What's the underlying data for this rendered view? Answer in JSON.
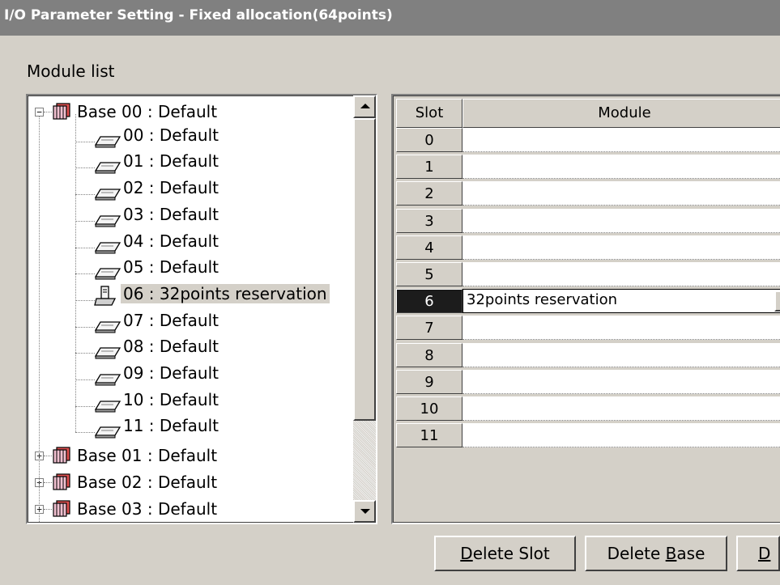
{
  "window": {
    "title": "I/O Parameter Setting - Fixed allocation(64points)"
  },
  "module_list": {
    "label": "Module list"
  },
  "tree": {
    "bases": [
      {
        "label": "Base 00 : Default",
        "expanded": true,
        "expander": "−",
        "children": [
          {
            "label": "00 : Default",
            "icon": "module-icon"
          },
          {
            "label": "01 : Default",
            "icon": "module-icon"
          },
          {
            "label": "02 : Default",
            "icon": "module-icon"
          },
          {
            "label": "03 : Default",
            "icon": "module-icon"
          },
          {
            "label": "04 : Default",
            "icon": "module-icon"
          },
          {
            "label": "05 : Default",
            "icon": "module-icon"
          },
          {
            "label": "06 : 32points reservation",
            "icon": "reservation-icon",
            "selected": true
          },
          {
            "label": "07 : Default",
            "icon": "module-icon"
          },
          {
            "label": "08 : Default",
            "icon": "module-icon"
          },
          {
            "label": "09 : Default",
            "icon": "module-icon"
          },
          {
            "label": "10 : Default",
            "icon": "module-icon"
          },
          {
            "label": "11 : Default",
            "icon": "module-icon"
          }
        ]
      },
      {
        "label": "Base 01 : Default",
        "expanded": false,
        "expander": "+"
      },
      {
        "label": "Base 02 : Default",
        "expanded": false,
        "expander": "+"
      },
      {
        "label": "Base 03 : Default",
        "expanded": false,
        "expander": "+"
      }
    ]
  },
  "grid": {
    "headers": {
      "slot": "Slot",
      "module": "Module"
    },
    "rows": [
      {
        "slot": "0",
        "module": ""
      },
      {
        "slot": "1",
        "module": ""
      },
      {
        "slot": "2",
        "module": ""
      },
      {
        "slot": "3",
        "module": ""
      },
      {
        "slot": "4",
        "module": ""
      },
      {
        "slot": "5",
        "module": ""
      },
      {
        "slot": "6",
        "module": "32points reservation",
        "active": true
      },
      {
        "slot": "7",
        "module": ""
      },
      {
        "slot": "8",
        "module": ""
      },
      {
        "slot": "9",
        "module": ""
      },
      {
        "slot": "10",
        "module": ""
      },
      {
        "slot": "11",
        "module": ""
      }
    ]
  },
  "buttons": {
    "delete_slot": {
      "mnemonic": "D",
      "rest": "elete Slot"
    },
    "delete_base": {
      "before": "Delete ",
      "mnemonic": "B",
      "rest": "ase"
    },
    "partial": {
      "mnemonic": "D"
    }
  },
  "colors": {
    "window_bg": "#d4d0c8",
    "title_bg": "#808080",
    "active_slot_bg": "#1c1c1c"
  }
}
